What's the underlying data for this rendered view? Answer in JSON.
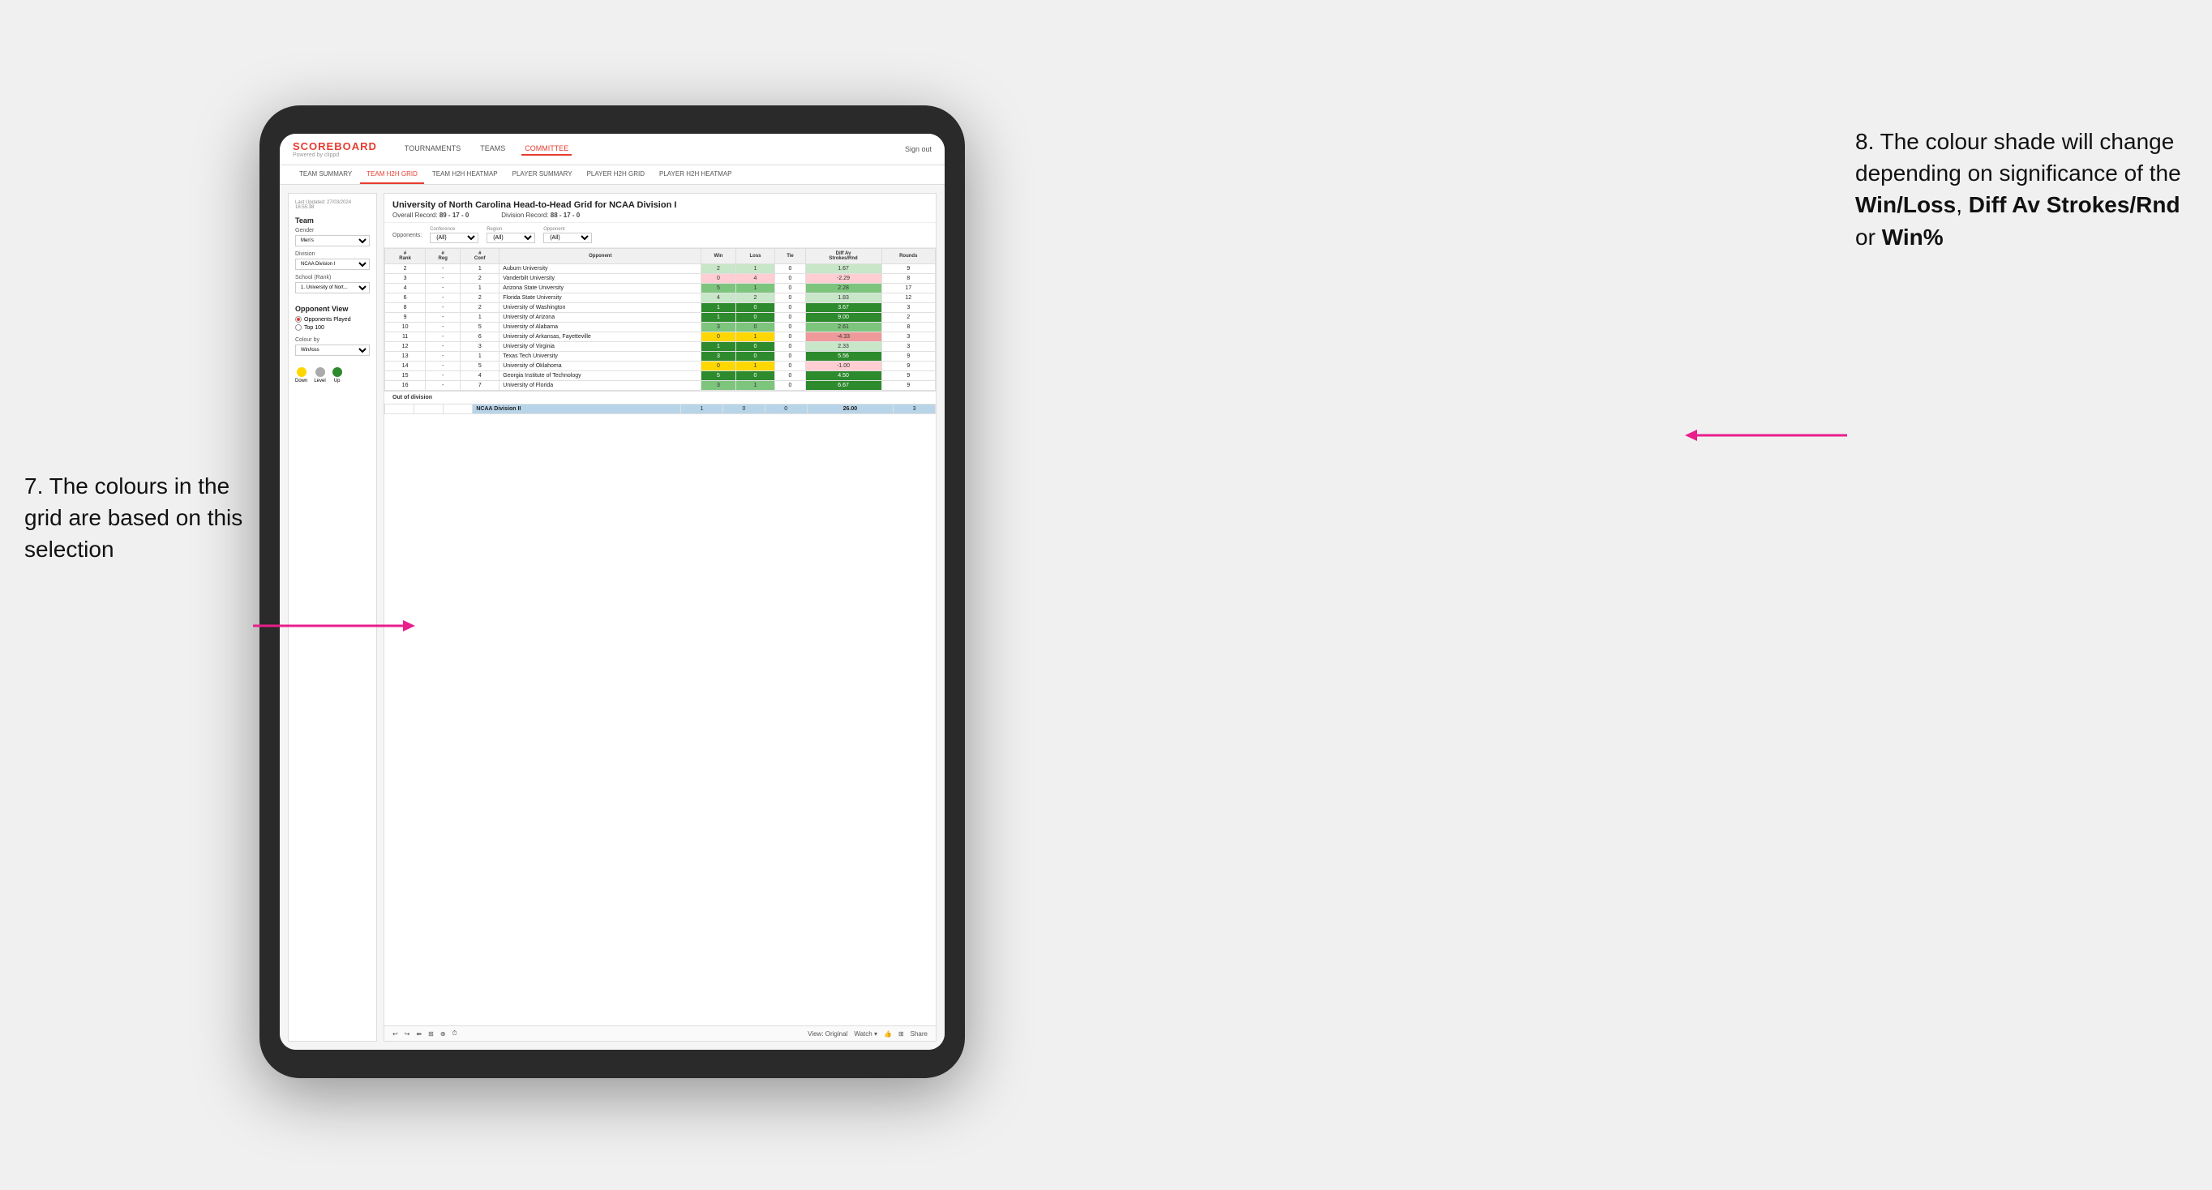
{
  "annotations": {
    "left_text": "7. The colours in the grid are based on this selection",
    "right_title": "8. The colour shade will change depending on significance of the",
    "right_bold1": "Win/Loss",
    "right_comma": ", ",
    "right_bold2": "Diff Av Strokes/Rnd",
    "right_or": " or ",
    "right_bold3": "Win%"
  },
  "nav": {
    "logo": "SCOREBOARD",
    "logo_sub": "Powered by clippd",
    "items": [
      "TOURNAMENTS",
      "TEAMS",
      "COMMITTEE"
    ],
    "active": "COMMITTEE",
    "sign_out": "Sign out"
  },
  "sub_nav": {
    "items": [
      "TEAM SUMMARY",
      "TEAM H2H GRID",
      "TEAM H2H HEATMAP",
      "PLAYER SUMMARY",
      "PLAYER H2H GRID",
      "PLAYER H2H HEATMAP"
    ],
    "active": "TEAM H2H GRID"
  },
  "left_panel": {
    "last_updated_label": "Last Updated: 27/03/2024",
    "last_updated_time": "16:55:38",
    "team_label": "Team",
    "gender_label": "Gender",
    "gender_value": "Men's",
    "division_label": "Division",
    "division_value": "NCAA Division I",
    "school_label": "School (Rank)",
    "school_value": "1. University of Nort...",
    "opponent_view_label": "Opponent View",
    "radio1": "Opponents Played",
    "radio2": "Top 100",
    "colour_by_label": "Colour by",
    "colour_by_value": "Win/loss",
    "legend": {
      "down_label": "Down",
      "level_label": "Level",
      "up_label": "Up"
    }
  },
  "grid": {
    "title": "University of North Carolina Head-to-Head Grid for NCAA Division I",
    "overall_record_label": "Overall Record:",
    "overall_record": "89 - 17 - 0",
    "division_record_label": "Division Record:",
    "division_record": "88 - 17 - 0",
    "filters": {
      "conference_label": "Conference",
      "conference_value": "(All)",
      "region_label": "Region",
      "region_value": "(All)",
      "opponent_label": "Opponent",
      "opponent_value": "(All)",
      "opponents_label": "Opponents:"
    },
    "columns": [
      "#\nRank",
      "#\nReg",
      "#\nConf",
      "Opponent",
      "Win",
      "Loss",
      "Tie",
      "Diff Av\nStrokes/Rnd",
      "Rounds"
    ],
    "rows": [
      {
        "rank": "2",
        "reg": "-",
        "conf": "1",
        "opponent": "Auburn University",
        "win": "2",
        "loss": "1",
        "tie": "0",
        "diff": "1.67",
        "rounds": "9",
        "win_color": "bg-green-light",
        "diff_color": "bg-green-light"
      },
      {
        "rank": "3",
        "reg": "-",
        "conf": "2",
        "opponent": "Vanderbilt University",
        "win": "0",
        "loss": "4",
        "tie": "0",
        "diff": "-2.29",
        "rounds": "8",
        "win_color": "bg-red-light",
        "diff_color": "bg-red-light"
      },
      {
        "rank": "4",
        "reg": "-",
        "conf": "1",
        "opponent": "Arizona State University",
        "win": "5",
        "loss": "1",
        "tie": "0",
        "diff": "2.28",
        "rounds": "17",
        "win_color": "bg-green-med",
        "diff_color": "bg-green-med"
      },
      {
        "rank": "6",
        "reg": "-",
        "conf": "2",
        "opponent": "Florida State University",
        "win": "4",
        "loss": "2",
        "tie": "0",
        "diff": "1.83",
        "rounds": "12",
        "win_color": "bg-green-light",
        "diff_color": "bg-green-light"
      },
      {
        "rank": "8",
        "reg": "-",
        "conf": "2",
        "opponent": "University of Washington",
        "win": "1",
        "loss": "0",
        "tie": "0",
        "diff": "3.67",
        "rounds": "3",
        "win_color": "bg-green-dark",
        "diff_color": "bg-green-dark"
      },
      {
        "rank": "9",
        "reg": "-",
        "conf": "1",
        "opponent": "University of Arizona",
        "win": "1",
        "loss": "0",
        "tie": "0",
        "diff": "9.00",
        "rounds": "2",
        "win_color": "bg-green-dark",
        "diff_color": "bg-green-dark"
      },
      {
        "rank": "10",
        "reg": "-",
        "conf": "5",
        "opponent": "University of Alabama",
        "win": "3",
        "loss": "0",
        "tie": "0",
        "diff": "2.61",
        "rounds": "8",
        "win_color": "bg-green-med",
        "diff_color": "bg-green-med"
      },
      {
        "rank": "11",
        "reg": "-",
        "conf": "6",
        "opponent": "University of Arkansas, Fayetteville",
        "win": "0",
        "loss": "1",
        "tie": "0",
        "diff": "-4.33",
        "rounds": "3",
        "win_color": "bg-yellow",
        "diff_color": "bg-red-med"
      },
      {
        "rank": "12",
        "reg": "-",
        "conf": "3",
        "opponent": "University of Virginia",
        "win": "1",
        "loss": "0",
        "tie": "0",
        "diff": "2.33",
        "rounds": "3",
        "win_color": "bg-green-dark",
        "diff_color": "bg-green-light"
      },
      {
        "rank": "13",
        "reg": "-",
        "conf": "1",
        "opponent": "Texas Tech University",
        "win": "3",
        "loss": "0",
        "tie": "0",
        "diff": "5.56",
        "rounds": "9",
        "win_color": "bg-green-dark",
        "diff_color": "bg-green-dark"
      },
      {
        "rank": "14",
        "reg": "-",
        "conf": "5",
        "opponent": "University of Oklahoma",
        "win": "0",
        "loss": "1",
        "tie": "0",
        "diff": "-1.00",
        "rounds": "9",
        "win_color": "bg-yellow",
        "diff_color": "bg-red-light"
      },
      {
        "rank": "15",
        "reg": "-",
        "conf": "4",
        "opponent": "Georgia Institute of Technology",
        "win": "5",
        "loss": "0",
        "tie": "0",
        "diff": "4.50",
        "rounds": "9",
        "win_color": "bg-green-dark",
        "diff_color": "bg-green-dark"
      },
      {
        "rank": "16",
        "reg": "-",
        "conf": "7",
        "opponent": "University of Florida",
        "win": "3",
        "loss": "1",
        "tie": "0",
        "diff": "6.67",
        "rounds": "9",
        "win_color": "bg-green-med",
        "diff_color": "bg-green-dark"
      }
    ],
    "out_of_division_label": "Out of division",
    "out_of_division_rows": [
      {
        "division": "NCAA Division II",
        "win": "1",
        "loss": "0",
        "tie": "0",
        "diff": "26.00",
        "rounds": "3"
      }
    ]
  },
  "toolbar": {
    "view_label": "View: Original",
    "watch_label": "Watch ▾",
    "share_label": "Share"
  }
}
